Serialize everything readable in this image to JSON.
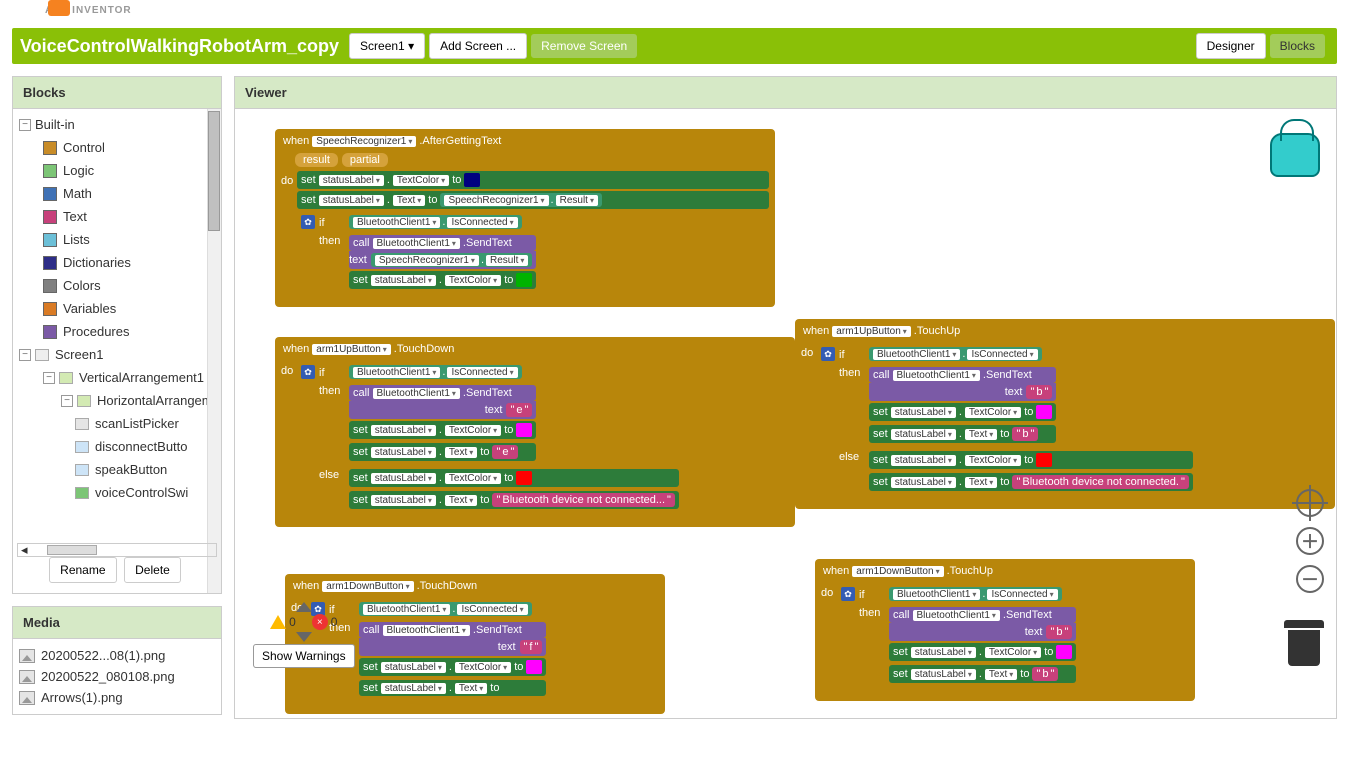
{
  "logo": "APP INVENTOR",
  "project_title": "VoiceControlWalkingRobotArm_copy",
  "screen_selector": "Screen1",
  "buttons": {
    "add_screen": "Add Screen ...",
    "remove_screen": "Remove Screen",
    "designer": "Designer",
    "blocks": "Blocks",
    "rename": "Rename",
    "delete": "Delete",
    "show_warnings": "Show Warnings"
  },
  "panels": {
    "blocks": "Blocks",
    "viewer": "Viewer",
    "media": "Media"
  },
  "builtin_label": "Built-in",
  "builtin": [
    {
      "label": "Control",
      "color": "#c88c28"
    },
    {
      "label": "Logic",
      "color": "#7cc576"
    },
    {
      "label": "Math",
      "color": "#3f71b5"
    },
    {
      "label": "Text",
      "color": "#c7417b"
    },
    {
      "label": "Lists",
      "color": "#6cc0d8"
    },
    {
      "label": "Dictionaries",
      "color": "#2d2d87"
    },
    {
      "label": "Colors",
      "color": "#808080"
    },
    {
      "label": "Variables",
      "color": "#d97b25"
    },
    {
      "label": "Procedures",
      "color": "#7b5aa6"
    }
  ],
  "components": {
    "screen": "Screen1",
    "va": "VerticalArrangement1",
    "ha": "HorizontalArrangem",
    "items": [
      "scanListPicker",
      "disconnectButto",
      "speakButton",
      "voiceControlSwi"
    ]
  },
  "media": [
    "20200522...08(1).png",
    "20200522_080108.png",
    "Arrows(1).png"
  ],
  "labels": {
    "when": "when",
    "do": "do",
    "set": "set",
    "to": "to",
    "call": "call",
    "text": "text",
    "if": "if",
    "then": "then",
    "else": "else",
    "result": "result",
    "partial": "partial"
  },
  "comp": {
    "speech": "SpeechRecognizer1",
    "status": "statusLabel",
    "bt": "BluetoothClient1",
    "arm1up": "arm1UpButton",
    "arm1down": "arm1DownButton"
  },
  "props": {
    "after_text": ".AfterGettingText",
    "text_color": "TextColor",
    "text_prop": "Text",
    "result": "Result",
    "isconn": "IsConnected",
    "sendtext": ".SendText",
    "touchdown": ".TouchDown",
    "touchup": ".TouchUp"
  },
  "strings": {
    "e": "e",
    "b": "b",
    "f": "f",
    "not_connected": "Bluetooth device not connected...",
    "not_connected_long": "Bluetooth device not connected."
  },
  "counts": {
    "warn": "0",
    "err": "0"
  }
}
